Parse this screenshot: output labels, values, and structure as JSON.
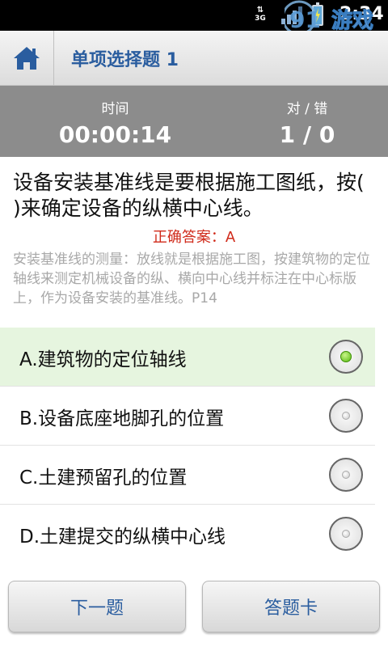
{
  "status_bar": {
    "network": "3G",
    "time": "2:34",
    "watermark_text": "91 游戏",
    "watermark_url": "91danji.com"
  },
  "header": {
    "title": "单项选择题 1",
    "home_icon": "home-icon"
  },
  "stats": {
    "time_label": "时间",
    "time_value": "00:00:14",
    "score_label": "对 / 错",
    "score_value": "1 / 0"
  },
  "question": {
    "text": "设备安装基准线是要根据施工图纸，按( )来确定设备的纵横中心线。",
    "correct_answer": "正确答案：A",
    "explanation": "安装基准线的测量：放线就是根据施工图，按建筑物的定位轴线来测定机械设备的纵、横向中心线并标注在中心标版上，作为设备安装的基准线。P14"
  },
  "options": [
    {
      "label": "A.建筑物的定位轴线",
      "selected": true
    },
    {
      "label": "B.设备底座地脚孔的位置",
      "selected": false
    },
    {
      "label": "C.土建预留孔的位置",
      "selected": false
    },
    {
      "label": "D.土建提交的纵横中心线",
      "selected": false
    }
  ],
  "buttons": {
    "next": "下一题",
    "answer_card": "答题卡"
  },
  "colors": {
    "accent": "#2a5d9f",
    "answer_red": "#d02a1a",
    "stats_bg": "#8c8c8c",
    "selected_bg": "#e6f5df"
  }
}
